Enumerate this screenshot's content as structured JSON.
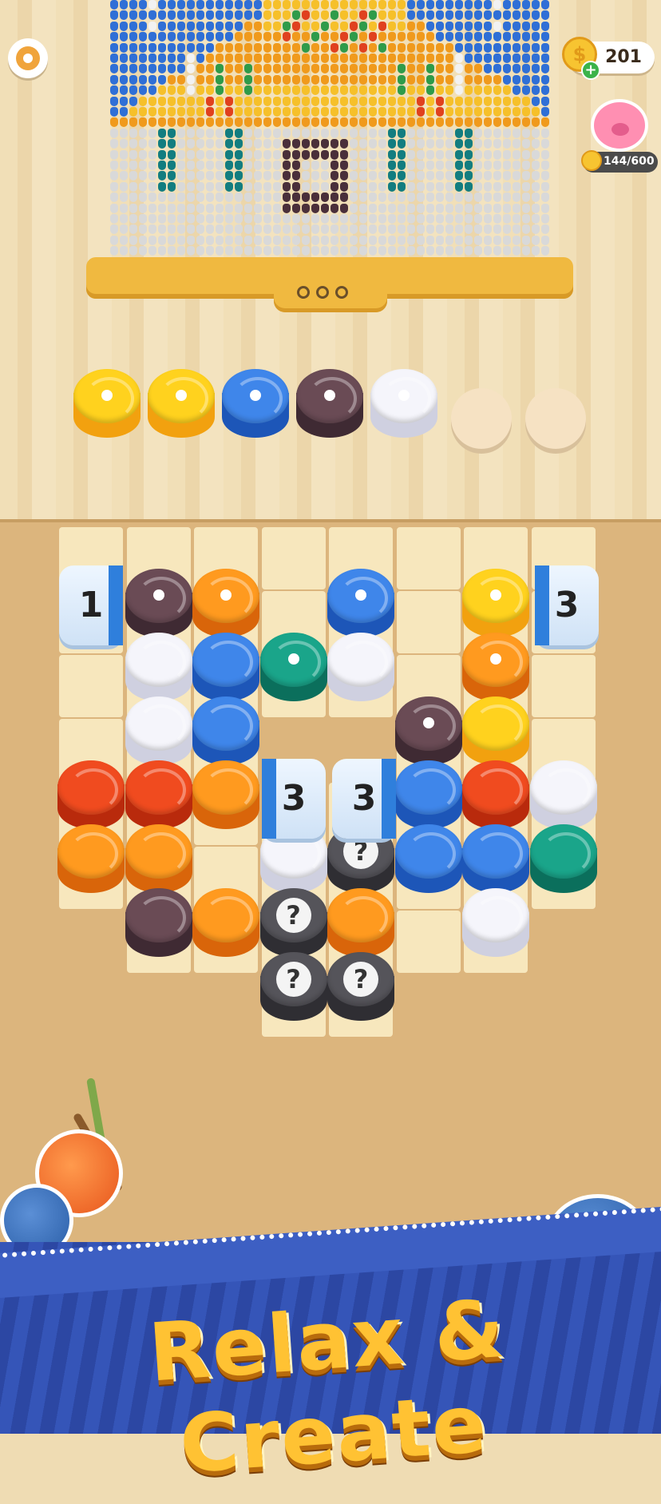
{
  "hud": {
    "coins": "201",
    "piggy_progress": "144/600",
    "settings_icon": "gear-icon",
    "coin_icon": "coin-icon",
    "piggy_icon": "piggy-bank-icon"
  },
  "tapestry": {
    "page_dots": 3,
    "palette": {
      "blue": "#2f6fd6",
      "white": "#f2f2f2",
      "orange": "#f09a1c",
      "yellow": "#f6c02a",
      "red": "#e0411f",
      "green": "#2f9b4a",
      "teal": "#127d80",
      "brown": "#4a2f3a",
      "grey": "#d9d9d9"
    }
  },
  "collected_slots": [
    {
      "color": "yellow"
    },
    {
      "color": "yellow"
    },
    {
      "color": "blue"
    },
    {
      "color": "brown"
    },
    {
      "color": "white"
    },
    {
      "color": "empty"
    },
    {
      "color": "empty"
    }
  ],
  "board": {
    "locks": [
      {
        "label": "1"
      },
      {
        "label": "3"
      },
      {
        "label": "3"
      },
      {
        "label": "3"
      }
    ],
    "mystery_label": "?"
  },
  "banner": {
    "title": "Relax & Create"
  }
}
